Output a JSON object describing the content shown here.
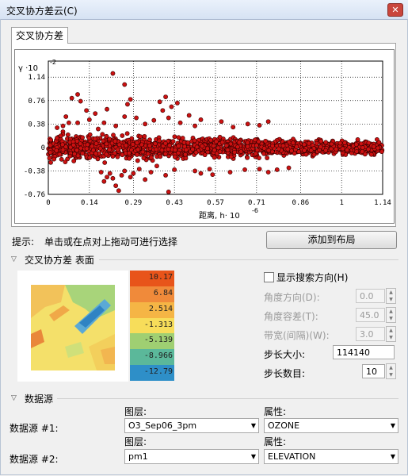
{
  "window": {
    "title": "交叉协方差云(C)",
    "close_glyph": "✕"
  },
  "tab": {
    "label": "交叉协方差"
  },
  "chart_data": {
    "type": "scatter",
    "ylabel": "γ ·10",
    "ylabel_exp": "-2",
    "xlabel": "距离, h· 10",
    "xlabel_exp": "-6",
    "xlim": [
      0,
      1.14
    ],
    "ylim": [
      -0.76,
      1.4
    ],
    "x_ticks": [
      0,
      0.14,
      0.29,
      0.43,
      0.57,
      0.71,
      0.86,
      1,
      1.14
    ],
    "x_tick_labels": [
      "0",
      "0.14",
      "0.29",
      "0.43",
      "0.57",
      "0.71",
      "0.86",
      "1",
      "1.14"
    ],
    "y_ticks": [
      -0.76,
      -0.38,
      0,
      0.38,
      0.76,
      1.14
    ],
    "y_tick_labels": [
      "-0.76",
      "-0.38",
      "0",
      "0.38",
      "0.76",
      "1.14"
    ],
    "point_color": "#cc1111",
    "point_stroke": "#330000",
    "grid": true,
    "outliers": [
      [
        0.22,
        1.2
      ],
      [
        0.26,
        1.02
      ],
      [
        0.08,
        0.8
      ],
      [
        0.1,
        0.86
      ],
      [
        0.11,
        0.75
      ],
      [
        0.06,
        0.5
      ],
      [
        0.05,
        0.35
      ],
      [
        0.07,
        0.4
      ],
      [
        0.13,
        0.6
      ],
      [
        0.16,
        0.55
      ],
      [
        0.2,
        0.62
      ],
      [
        0.27,
        0.7
      ],
      [
        0.28,
        0.78
      ],
      [
        0.26,
        0.5
      ],
      [
        0.3,
        0.48
      ],
      [
        0.38,
        0.74
      ],
      [
        0.39,
        0.6
      ],
      [
        0.4,
        0.82
      ],
      [
        0.42,
        0.66
      ],
      [
        0.44,
        0.72
      ],
      [
        0.41,
        0.48
      ],
      [
        0.45,
        0.4
      ],
      [
        0.36,
        0.44
      ],
      [
        0.33,
        0.38
      ],
      [
        0.5,
        0.35
      ],
      [
        0.52,
        0.45
      ],
      [
        0.48,
        0.52
      ],
      [
        0.59,
        0.42
      ],
      [
        0.63,
        0.33
      ],
      [
        0.68,
        0.38
      ],
      [
        0.72,
        0.36
      ],
      [
        0.75,
        0.42
      ],
      [
        0.23,
        0.35
      ],
      [
        0.19,
        0.4
      ],
      [
        0.14,
        0.45
      ],
      [
        0.1,
        0.4
      ],
      [
        0.03,
        0.32
      ],
      [
        0.17,
        0.3
      ],
      [
        0.21,
        -0.42
      ],
      [
        0.22,
        -0.5
      ],
      [
        0.23,
        -0.62
      ],
      [
        0.24,
        -0.7
      ],
      [
        0.19,
        -0.55
      ],
      [
        0.2,
        -0.48
      ],
      [
        0.18,
        -0.4
      ],
      [
        0.25,
        -0.45
      ],
      [
        0.26,
        -0.38
      ],
      [
        0.29,
        -0.42
      ],
      [
        0.31,
        -0.35
      ],
      [
        0.35,
        -0.4
      ],
      [
        0.4,
        -0.45
      ],
      [
        0.43,
        -0.36
      ],
      [
        0.41,
        -0.72
      ],
      [
        0.5,
        -0.38
      ],
      [
        0.52,
        -0.42
      ],
      [
        0.55,
        -0.35
      ],
      [
        0.56,
        -0.44
      ],
      [
        0.62,
        -0.4
      ],
      [
        0.67,
        -0.36
      ],
      [
        0.72,
        -0.35
      ],
      [
        0.75,
        -0.4
      ],
      [
        0.78,
        -0.36
      ],
      [
        0.82,
        -0.33
      ],
      [
        0.28,
        -0.48
      ],
      [
        0.33,
        -0.52
      ],
      [
        0.37,
        -0.3
      ]
    ]
  },
  "hint": {
    "label": "提示:",
    "text": "单击或在点对上拖动可进行选择"
  },
  "add_to_layout_button": "添加到布局",
  "surface_section": {
    "title": "交叉协方差 表面"
  },
  "legend_values": [
    "10.17",
    "6.84",
    "2.514",
    "-1.313",
    "-5.139",
    "-8.966",
    "-12.79"
  ],
  "legend_colors": [
    "#e8541a",
    "#f08a3a",
    "#f5b545",
    "#f7dd5a",
    "#9fcf72",
    "#5bb89a",
    "#2e8fc8"
  ],
  "show_search_direction": {
    "label": "显示搜索方向(H)",
    "checked": false
  },
  "angle_direction": {
    "label": "角度方向(D):",
    "value": "0.0"
  },
  "angle_tolerance": {
    "label": "角度容差(T):",
    "value": "45.0"
  },
  "bandwidth": {
    "label": "带宽(间隔)(W):",
    "value": "3.0"
  },
  "lag_size": {
    "label": "步长大小:",
    "value": "114140"
  },
  "lag_count": {
    "label": "步长数目:",
    "value": "10"
  },
  "datasource_section": {
    "title": "数据源"
  },
  "layer_header": "图层:",
  "attribute_header": "属性:",
  "datasource1": {
    "label": "数据源 #1:",
    "layer": "O3_Sep06_3pm",
    "attribute": "OZONE"
  },
  "datasource2": {
    "label": "数据源 #2:",
    "layer": "pm1",
    "attribute": "ELEVATION"
  }
}
